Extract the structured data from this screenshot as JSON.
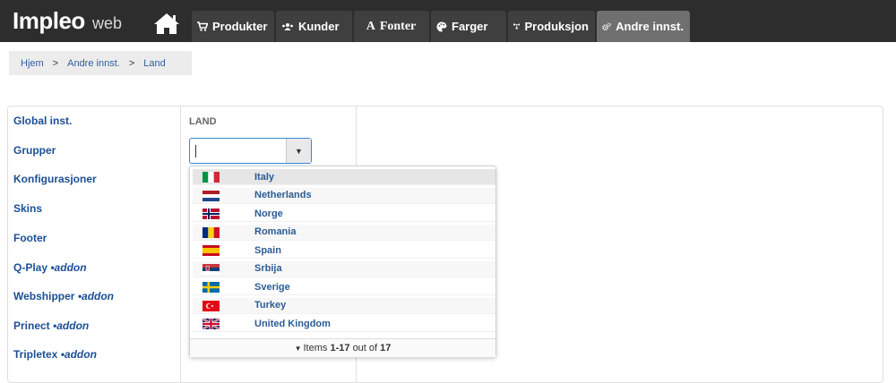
{
  "brand": {
    "name": "Impleo",
    "suffix": "web"
  },
  "tabs": [
    {
      "label": "Produkter",
      "icon": "cart-icon"
    },
    {
      "label": "Kunder",
      "icon": "users-icon"
    },
    {
      "label": "Fonter",
      "icon": "font-icon"
    },
    {
      "label": "Farger",
      "icon": "palette-icon"
    },
    {
      "label": "Produksjon",
      "icon": "sitemap-icon"
    },
    {
      "label": "Andre innst.",
      "icon": "cogs-icon",
      "active": true
    }
  ],
  "breadcrumb": [
    "Hjem",
    "Andre innst.",
    "Land"
  ],
  "breadcrumb_separator": ">",
  "sidebar": {
    "items": [
      {
        "label": "Global inst.",
        "addon": ""
      },
      {
        "label": "Grupper",
        "addon": ""
      },
      {
        "label": "Konfigurasjoner",
        "addon": ""
      },
      {
        "label": "Skins",
        "addon": ""
      },
      {
        "label": "Footer",
        "addon": ""
      },
      {
        "label": "Q-Play",
        "addon": "•addon"
      },
      {
        "label": "Webshipper",
        "addon": "•addon"
      },
      {
        "label": "Prinect",
        "addon": "•addon"
      },
      {
        "label": "Tripletex",
        "addon": "•addon"
      }
    ]
  },
  "main": {
    "section_title": "LAND",
    "combo_value": "",
    "dropdown": {
      "options": [
        {
          "name": "Italy",
          "flag": "IT"
        },
        {
          "name": "Netherlands",
          "flag": "NL"
        },
        {
          "name": "Norge",
          "flag": "NO"
        },
        {
          "name": "Romania",
          "flag": "RO"
        },
        {
          "name": "Spain",
          "flag": "ES"
        },
        {
          "name": "Srbija",
          "flag": "RS"
        },
        {
          "name": "Sverige",
          "flag": "SE"
        },
        {
          "name": "Turkey",
          "flag": "TR"
        },
        {
          "name": "United Kingdom",
          "flag": "GB"
        }
      ],
      "pager": {
        "prefix": "Items",
        "range": "1-17",
        "middle": "out of",
        "total": "17"
      }
    }
  },
  "colors": {
    "topbar": "#2d2d2d",
    "tab": "#3f3f3f",
    "tab_active": "#6f6f6f",
    "link": "#1c4f96"
  }
}
